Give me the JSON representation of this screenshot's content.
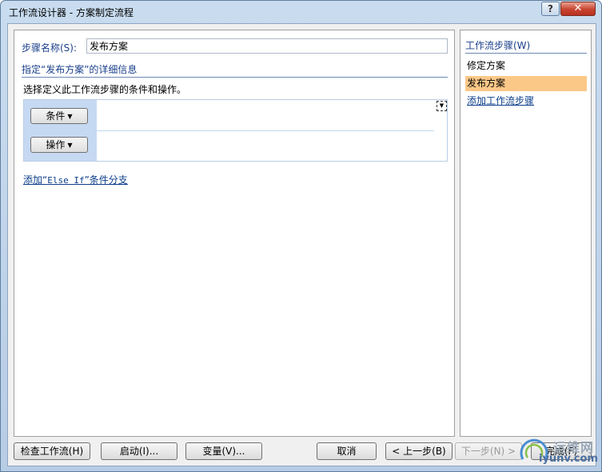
{
  "window": {
    "title": "工作流设计器 - 方案制定流程",
    "help_label": "?",
    "close_label": "✕"
  },
  "left_panel": {
    "step_name_label": "步骤名称(S):",
    "step_name_value": "发布方案",
    "section_heading": "指定“发布方案”的详细信息",
    "instruction": "选择定义此工作流步骤的条件和操作。",
    "conditions_label": "条件",
    "actions_label": "操作",
    "dropdown_arrow": "▼",
    "corner_menu_arrow": "▼",
    "else_if_prefix": "添加“",
    "else_if_code": "Else If",
    "else_if_suffix": "”条件分支"
  },
  "right_panel": {
    "heading": "工作流步骤(W)",
    "steps": [
      {
        "label": "修定方案",
        "selected": false
      },
      {
        "label": "发布方案",
        "selected": true
      }
    ],
    "add_step_link": "添加工作流步骤"
  },
  "bottom_buttons": {
    "check": "检查工作流(H)",
    "initiation": "启动(I)...",
    "variables": "变量(V)...",
    "cancel": "取消",
    "back": "< 上一步(B)",
    "next": "下一步(N) >",
    "finish": "完成(F)"
  },
  "watermark": {
    "name": "运维网",
    "domain": "iyunv.com"
  },
  "colors": {
    "selected_step": "#fcc888",
    "link": "#0b3e8a",
    "heading_text": "#1a3f8a",
    "rule_gutter": "#c6d9f2"
  }
}
